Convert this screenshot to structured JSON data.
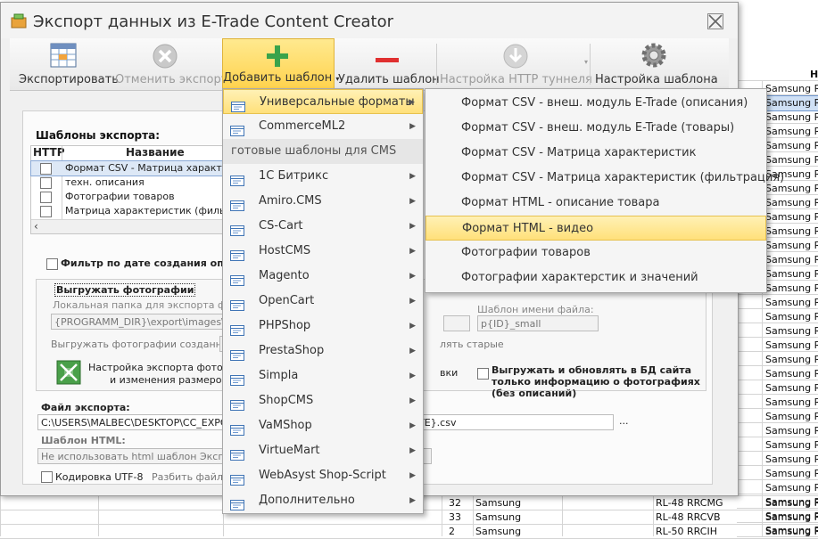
{
  "app": {
    "title": "Экспорт данных из E-Trade Content Creator"
  },
  "toolbar": {
    "export": "Экспортировать",
    "cancel_export": "Отменить экспорт",
    "add_template": "Добавить шаблон",
    "remove_template": "Удалить шаблон",
    "http_tunnel": "Настройка HTTP туннеля",
    "template_settings": "Настройка шаблона"
  },
  "templates": {
    "heading": "Шаблоны экспорта:",
    "col_http": "HTTP",
    "col_name": "Название",
    "rows": [
      "Формат CSV - Матрица характер",
      "техн. описания",
      "Фотографии товаров",
      "Матрица характеристик (фильтра"
    ]
  },
  "options": {
    "filter_by_date": "Фильтр по дате создания описа",
    "export_photos": "Выгружать фотографии",
    "local_folder_label": "Локальная папка для экспорта фотогр",
    "local_folder_value": "{PROGRAMM_DIR}\\export\\images\\",
    "export_created_label": "Выгружать фотографии созданные",
    "photo_settings_line1": "Настройка экспорта фотограф",
    "photo_settings_line2": "и изменения размеров",
    "filename_template_label": "Шаблон имени файла:",
    "filename_template_value": "p{ID}_small",
    "replace_old": "лять старые",
    "downloads_partial": "вки",
    "upload_only_photos": "Выгружать и обновлять в БД сайта только информацию о фотографиях (без описаний)",
    "export_file_label": "Файл экспорта:",
    "export_file_value": "C:\\USERS\\MALBEC\\DESKTOP\\CC_EXPORT\\",
    "export_file_suffix": "TE}.csv",
    "browse": "...",
    "html_template_label": "Шаблон HTML:",
    "html_template_value": "Не использовать html шаблон Экспорт",
    "utf8": "Кодировка UTF-8",
    "split_file": "Разбить файл эк"
  },
  "main_menu": {
    "items": [
      {
        "label": "Универсальные форматы",
        "highlighted": true
      },
      {
        "label": "CommerceML2"
      }
    ],
    "section_header": "готовые шаблоны для CMS",
    "cms": [
      "1С Битрикс",
      "Amiro.CMS",
      "CS-Cart",
      "HostCMS",
      "Magento",
      "OpenCart",
      "PHPShop",
      "PrestaShop",
      "Simpla",
      "ShopCMS",
      "VaMShop",
      "VirtueMart",
      "WebAsyst Shop-Script",
      "Дополнительно"
    ]
  },
  "submenu": {
    "items": [
      "Формат CSV - внеш. модуль E-Trade (описания)",
      "Формат CSV - внеш. модуль E-Trade (товары)",
      "Формат CSV - Матрица характеристик",
      "Формат CSV - Матрица характеристик (фильтрация)",
      "Формат HTML - описание товара",
      "Формат HTML - видео",
      "Фотографии товаров",
      "Фотографии характерстик и значений"
    ],
    "highlighted_index": 5
  },
  "background_sheet": {
    "right_col_header": "Н",
    "right_col_values": [
      "Samsung RB",
      "Samsung RB",
      "Samsung RB",
      "Samsung RB",
      "Samsung RB",
      "Samsung RB",
      "Samsung RB",
      "Samsung RB",
      "Samsung RB",
      "Samsung RB",
      "Samsung RB",
      "Samsung RB",
      "Samsung RB",
      "Samsung RB",
      "Samsung RB",
      "Samsung RB",
      "Samsung RB",
      "Samsung RB",
      "Samsung RB",
      "Samsung RF",
      "Samsung RF",
      "Samsung RF",
      "Samsung RL-",
      "Samsung RL-",
      "Samsung RL-",
      "Samsung RL-",
      "Samsung RL-",
      "Samsung RL-",
      "Samsung RL-",
      "Samsung RL-",
      "Samsung RL-",
      "Samsung RL-"
    ],
    "bottom_rows": [
      {
        "num": "32",
        "brand": "Samsung",
        "model": "RL-48 RRCMG",
        "name": "Samsung RL-"
      },
      {
        "num": "33",
        "brand": "Samsung",
        "model": "RL-48 RRCVB",
        "name": "Samsung RL-"
      },
      {
        "num": "2",
        "brand": "Samsung",
        "model": "RL-50 RRCIH",
        "name": "Samsung RL-"
      }
    ]
  },
  "colors": {
    "accent": "#ffd34e",
    "highlight": "#ffe07a",
    "add_icon": "#3aa34b",
    "remove_icon": "#e03030"
  }
}
